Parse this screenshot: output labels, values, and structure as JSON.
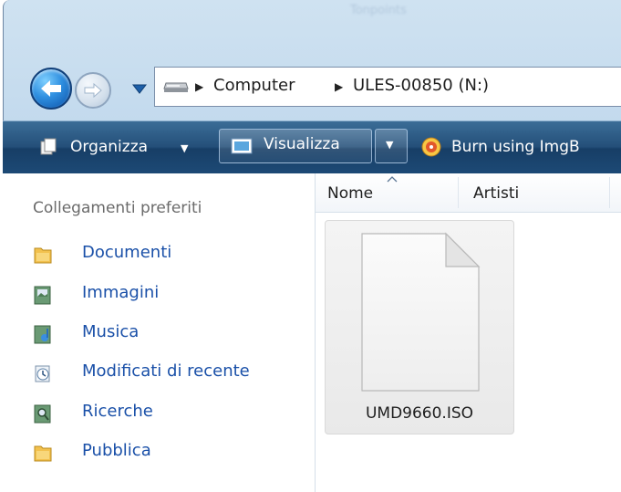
{
  "window": {
    "title": "Tonpoints"
  },
  "address": {
    "crumbs": [
      "Computer",
      "ULES-00850 (N:)"
    ]
  },
  "toolbar": {
    "organize_label": "Organizza",
    "view_label": "Visualizza",
    "burn_label": "Burn using ImgB"
  },
  "nav_pane": {
    "header": "Collegamenti preferiti",
    "items": [
      {
        "label": "Documenti",
        "icon": "folder-icon"
      },
      {
        "label": "Immagini",
        "icon": "pictures-icon"
      },
      {
        "label": "Musica",
        "icon": "music-icon"
      },
      {
        "label": "Modificati di recente",
        "icon": "recent-icon"
      },
      {
        "label": "Ricerche",
        "icon": "searches-icon"
      },
      {
        "label": "Pubblica",
        "icon": "folder-icon"
      }
    ]
  },
  "content": {
    "columns": [
      "Nome",
      "Artisti"
    ],
    "files": [
      {
        "name": "UMD9660.ISO",
        "icon": "file-icon"
      }
    ]
  },
  "colors": {
    "toolbar": "#1d4a76",
    "link": "#1a50a8",
    "frame": "#b9d3ea"
  }
}
